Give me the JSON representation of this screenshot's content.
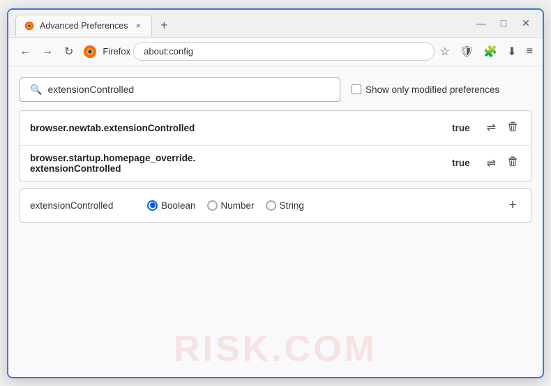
{
  "window": {
    "title": "Advanced Preferences",
    "tab_close": "×",
    "new_tab": "+",
    "minimize": "—",
    "maximize": "□",
    "close": "✕"
  },
  "navbar": {
    "back": "←",
    "forward": "→",
    "refresh": "↻",
    "browser_name": "Firefox",
    "address": "about:config",
    "bookmark_icon": "☆",
    "shield_icon": "🛡",
    "extension_icon": "🧩",
    "download_icon": "⬇",
    "menu_icon": "≡"
  },
  "search": {
    "placeholder": "extensionControlled",
    "value": "extensionControlled",
    "search_icon": "🔍",
    "show_modified_label": "Show only modified preferences"
  },
  "preferences": [
    {
      "name": "browser.newtab.extensionControlled",
      "value": "true"
    },
    {
      "name_line1": "browser.startup.homepage_override.",
      "name_line2": "extensionControlled",
      "value": "true"
    }
  ],
  "add_row": {
    "name": "extensionControlled",
    "type_boolean": "Boolean",
    "type_number": "Number",
    "type_string": "String",
    "add_icon": "+"
  },
  "watermark": "RISK.COM"
}
